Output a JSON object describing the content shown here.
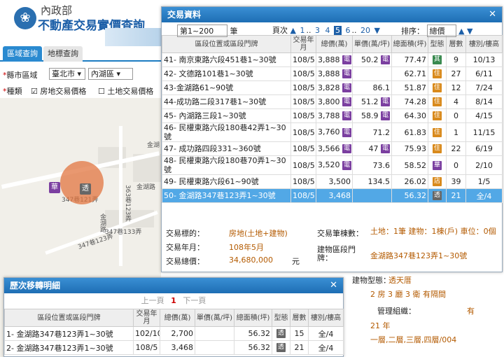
{
  "header": {
    "agency": "內政部",
    "title": "不動產交易實價查詢"
  },
  "tabs": {
    "area": "區域查詢",
    "landmark": "地標查詢"
  },
  "filters": {
    "city_label": "縣市區域",
    "city": "臺北市",
    "district": "內湖區",
    "type_label": "種類",
    "opt_house": "房地交易價格",
    "opt_land": "土地交易價格"
  },
  "map": {
    "labels": [
      "金湖",
      "金湖路",
      "363巷123弄",
      "347巷121弄",
      "347巷133弄",
      "347巷123弄",
      "金湖路"
    ],
    "marker_hua": "華",
    "marker_tou": "透"
  },
  "dialog": {
    "title": "交易資料",
    "range": "第1~200",
    "range_suffix": "筆",
    "page_label": "頁次",
    "pages": [
      "1",
      "3",
      "4",
      "5",
      "6",
      "20"
    ],
    "page_current": "5",
    "sort_label": "排序：",
    "sort_value": "總價"
  },
  "table": {
    "headers": [
      "區段位置或區段門牌",
      "交易年月",
      "總價(萬)",
      "單價(萬/坪)",
      "總面積(坪)",
      "型態",
      "層數",
      "樓別/樓高"
    ],
    "rows": [
      {
        "no": "41",
        "addr": "- 南京東路六段451巷1~30號",
        "ym": "108/5",
        "total": "3,888",
        "icon": "電",
        "unit": "50.2",
        "uicon": "電",
        "area": "77.47",
        "type": "其",
        "floors": "9",
        "fl": "10/13"
      },
      {
        "no": "42",
        "addr": "- 文德路101巷1~30號",
        "ym": "108/5",
        "total": "3,888",
        "icon": "電",
        "unit": "",
        "uicon": "",
        "area": "62.71",
        "type": "住",
        "floors": "27",
        "fl": "6/11"
      },
      {
        "no": "43",
        "addr": "-金湖路61~90號",
        "ym": "108/5",
        "total": "3,828",
        "icon": "電",
        "unit": "86.1",
        "uicon": "",
        "area": "51.87",
        "type": "住",
        "floors": "12",
        "fl": "7/24"
      },
      {
        "no": "44",
        "addr": "-成功路二段317巷1~30號",
        "ym": "108/5",
        "total": "3,800",
        "icon": "電",
        "unit": "51.2",
        "uicon": "電",
        "area": "74.28",
        "type": "住",
        "floors": "4",
        "fl": "8/14"
      },
      {
        "no": "45",
        "addr": "- 內湖路三段1~30號",
        "ym": "108/5",
        "total": "3,788",
        "icon": "電",
        "unit": "58.9",
        "uicon": "電",
        "area": "64.30",
        "type": "住",
        "floors": "0",
        "fl": "4/15"
      },
      {
        "no": "46",
        "addr": "- 民權東路六段180巷42弄1~30號",
        "ym": "108/5",
        "total": "3,760",
        "icon": "電",
        "unit": "71.2",
        "uicon": "",
        "area": "61.83",
        "type": "住",
        "floors": "1",
        "fl": "11/15"
      },
      {
        "no": "47",
        "addr": "- 成功路四段331~360號",
        "ym": "108/5",
        "total": "3,566",
        "icon": "電",
        "unit": "47",
        "uicon": "電",
        "area": "75.93",
        "type": "住",
        "floors": "22",
        "fl": "6/19"
      },
      {
        "no": "48",
        "addr": "- 民權東路六段180巷70弄1~30號",
        "ym": "108/5",
        "total": "3,520",
        "icon": "電",
        "unit": "73.6",
        "uicon": "",
        "area": "58.52",
        "type": "華",
        "floors": "0",
        "fl": "2/10"
      },
      {
        "no": "49",
        "addr": "- 民權東路六段61~90號",
        "ym": "108/5",
        "total": "3,500",
        "icon": "",
        "unit": "134.5",
        "uicon": "",
        "area": "26.02",
        "type": "店",
        "floors": "39",
        "fl": "1/5"
      },
      {
        "no": "50",
        "addr": "- 金湖路347巷123弄1~30號",
        "ym": "108/5",
        "total": "3,468",
        "icon": "",
        "unit": "",
        "uicon": "",
        "area": "56.32",
        "type": "透",
        "floors": "21",
        "fl": "全/4"
      }
    ]
  },
  "detail": {
    "target_label": "交易標的：",
    "target": "房地(土地+建物)",
    "ym_label": "交易年月：",
    "ym": "108年5月",
    "total_label": "交易總價：",
    "total": "34,680,000",
    "total_unit": "元",
    "count_label": "交易筆棟數：",
    "count": "土地：1筆 建物：1棟(戶) 車位：0個",
    "bld_label": "建物區段門牌：",
    "bld": "金湖路347巷123弄1~30號",
    "bld_type_label": "建物型態：",
    "bld_type": "透天厝"
  },
  "background_detail": {
    "rooms": "2 房 3 廳 3 衛 有隔間",
    "mgmt_label": "管理組織：",
    "mgmt": "有",
    "age": "21 年",
    "floors": "一層,二層,三層,四層/004"
  },
  "history": {
    "title": "歷次移轉明細",
    "prev": "上一頁",
    "page": "1",
    "next": "下一頁",
    "headers": [
      "區段位置或區段門牌",
      "交易年月",
      "總價(萬)",
      "單價(萬/坪)",
      "總面積(坪)",
      "型態",
      "層數",
      "樓別/樓高"
    ],
    "rows": [
      {
        "no": "1",
        "addr": "- 金湖路347巷123弄1~30號",
        "ym": "102/10",
        "total": "2,700",
        "unit": "",
        "area": "56.32",
        "type": "透",
        "floors": "15",
        "fl": "全/4"
      },
      {
        "no": "2",
        "addr": "- 金湖路347巷123弄1~30號",
        "ym": "108/5",
        "total": "3,468",
        "unit": "",
        "area": "56.32",
        "type": "透",
        "floors": "21",
        "fl": "全/4"
      }
    ]
  },
  "colors": {
    "accent": "#1e6eb4",
    "select_row": "#52a8e6",
    "icon_purple": "#7b3fa0",
    "icon_orange": "#d98a1c",
    "icon_green": "#3a8a50",
    "icon_gray": "#666666",
    "value": "#b35a00"
  }
}
